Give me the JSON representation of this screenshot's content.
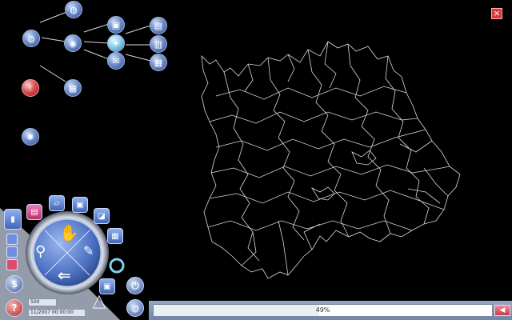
{
  "window": {
    "close_glyph": "×"
  },
  "tool_nodes": [
    {
      "icon": "globe-network-icon",
      "glyph": "◍"
    },
    {
      "icon": "globe-icon",
      "glyph": "◍"
    },
    {
      "icon": "network-hub-icon",
      "glyph": "◉"
    },
    {
      "icon": "save-disk-icon",
      "glyph": "▣"
    },
    {
      "icon": "compass-target-icon",
      "glyph": "✦"
    },
    {
      "icon": "mail-icon",
      "glyph": "✉"
    },
    {
      "icon": "map-stack-icon",
      "glyph": "▤"
    },
    {
      "icon": "server-icon",
      "glyph": "▥"
    },
    {
      "icon": "building-icon",
      "glyph": "▦"
    },
    {
      "icon": "warning-icon",
      "glyph": "!"
    },
    {
      "icon": "calendar-icon",
      "glyph": "▦"
    },
    {
      "icon": "sun-settings-icon",
      "glyph": "✺"
    }
  ],
  "controls": {
    "stats_glyph": "▮",
    "help_glyph": "?",
    "scale_value": "500",
    "date_value": "11/2007 00:00:00",
    "date_prefix": "11",
    "back_arrow": "⇐",
    "pan_glyph": "✋",
    "zoom_glyph": "⚲",
    "edit_glyph": "✎",
    "ring_glyph": "◎",
    "layers_glyph": "▣",
    "nav_glyph": "△"
  },
  "progress": {
    "percent": 49,
    "label": "49%"
  },
  "footer": {
    "back_glyph": "◀"
  }
}
